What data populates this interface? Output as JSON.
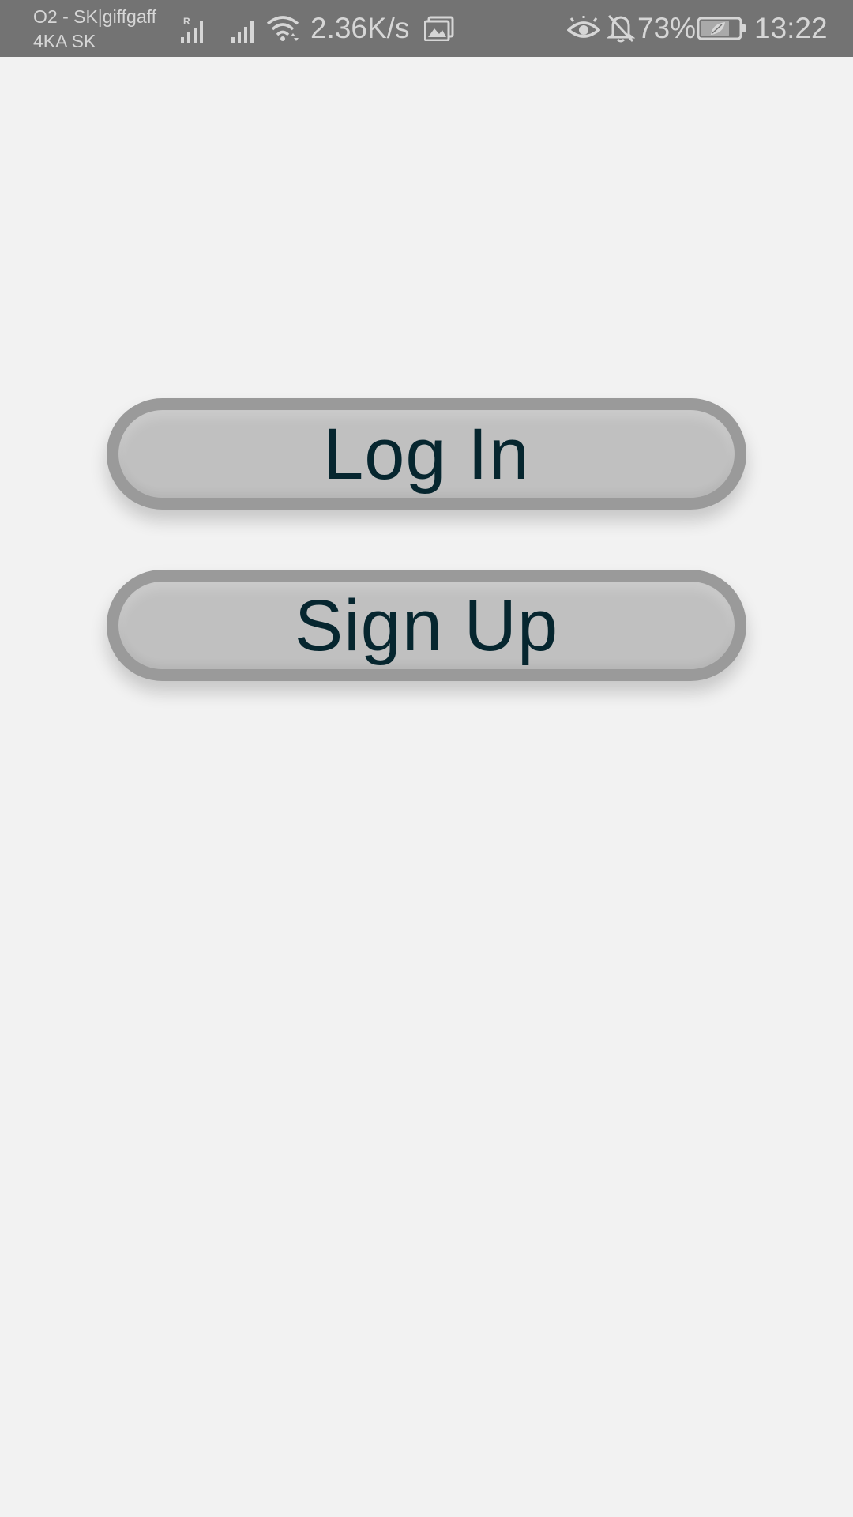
{
  "status_bar": {
    "carrier_line1": "O2 - SK|giffgaff",
    "carrier_line2": "4KA SK",
    "network_speed": "2.36K/s",
    "battery_percent": "73%",
    "time": "13:22",
    "icons": [
      "roaming-signal-icon",
      "signal-icon",
      "wifi-icon",
      "gallery-notification-icon",
      "eye-comfort-icon",
      "bell-off-icon",
      "battery-icon"
    ],
    "background_color": "#737373",
    "text_color": "#d6d6d6"
  },
  "screen": {
    "background_color": "#f2f2f2",
    "buttons": {
      "login_label": "Log In",
      "signup_label": "Sign Up",
      "fill_color": "#c0c0c0",
      "border_color": "#9a9a9a",
      "text_color": "#06262f"
    }
  }
}
